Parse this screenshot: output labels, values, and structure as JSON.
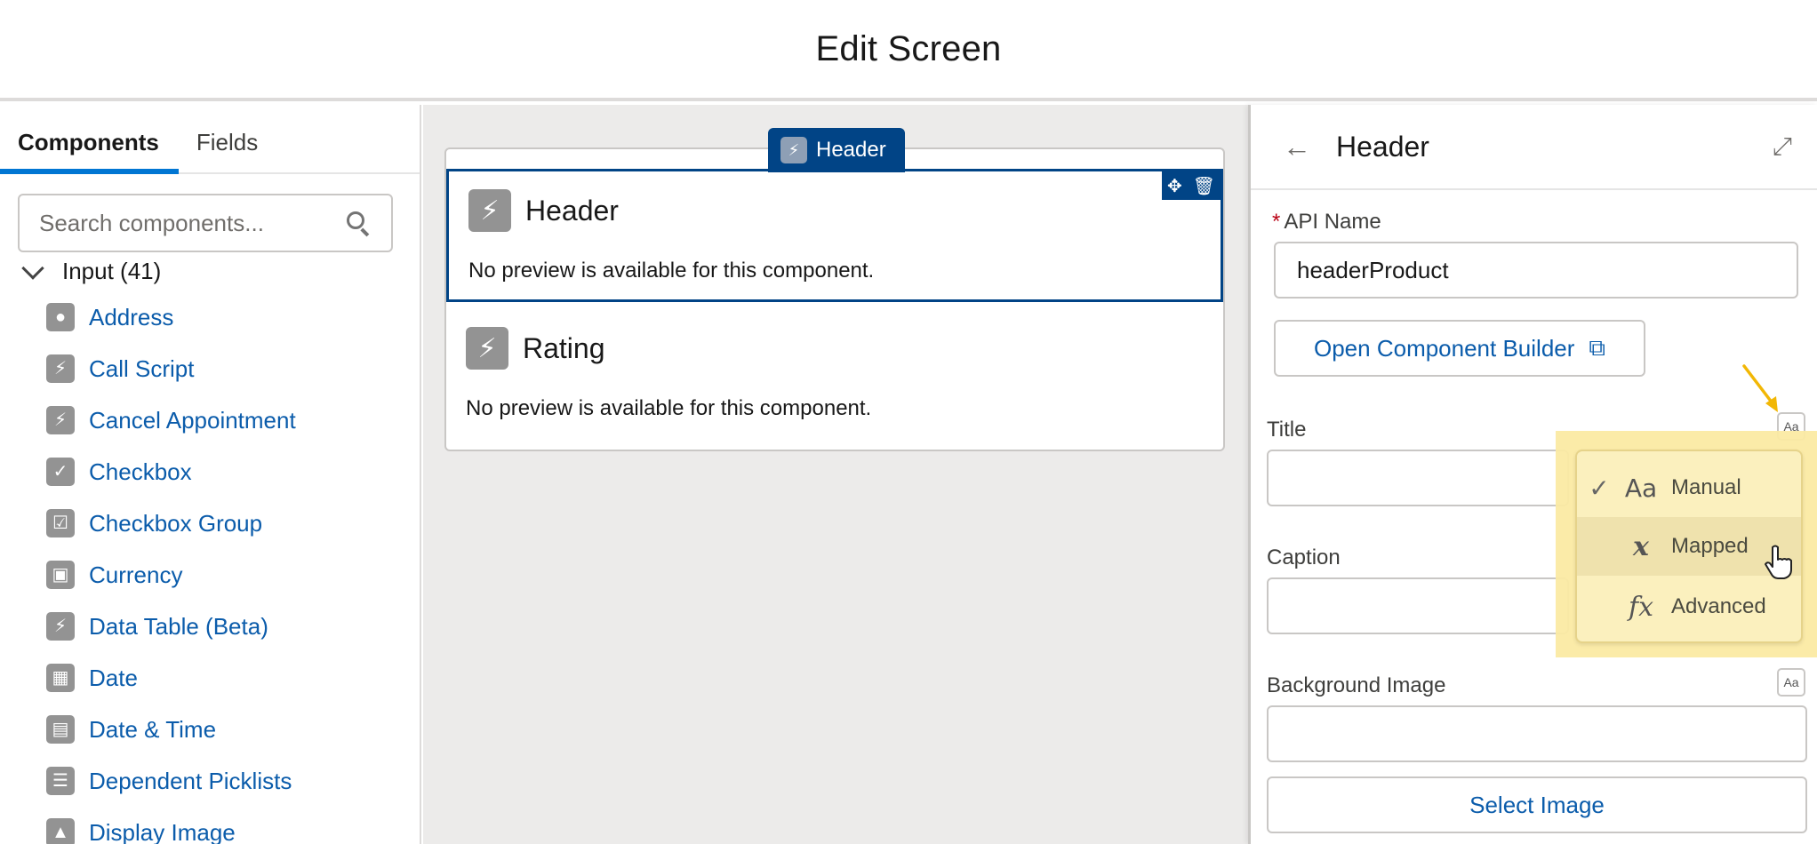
{
  "page": {
    "title": "Edit Screen"
  },
  "left_panel": {
    "tabs": [
      {
        "label": "Components",
        "active": true
      },
      {
        "label": "Fields",
        "active": false
      }
    ],
    "search": {
      "placeholder": "Search components..."
    },
    "section": {
      "label": "Input (41)"
    },
    "items": [
      {
        "label": "Address",
        "icon": "location-icon"
      },
      {
        "label": "Call Script",
        "icon": "lightning-icon"
      },
      {
        "label": "Cancel Appointment",
        "icon": "lightning-icon"
      },
      {
        "label": "Checkbox",
        "icon": "check-icon"
      },
      {
        "label": "Checkbox Group",
        "icon": "checkbox-group-icon"
      },
      {
        "label": "Currency",
        "icon": "currency-icon"
      },
      {
        "label": "Data Table (Beta)",
        "icon": "lightning-icon"
      },
      {
        "label": "Date",
        "icon": "calendar-icon"
      },
      {
        "label": "Date & Time",
        "icon": "calendar-time-icon"
      },
      {
        "label": "Dependent Picklists",
        "icon": "list-icon"
      },
      {
        "label": "Display Image",
        "icon": "image-icon"
      }
    ]
  },
  "canvas": {
    "tag_label": "Header",
    "components": [
      {
        "title": "Header",
        "description": "No preview is available for this component.",
        "selected": true
      },
      {
        "title": "Rating",
        "description": "No preview is available for this component.",
        "selected": false
      }
    ]
  },
  "properties": {
    "title": "Header",
    "api_name_label": "API Name",
    "api_name_required": "*",
    "api_name_value": "headerProduct",
    "open_builder_label": "Open Component Builder",
    "title_label": "Title",
    "caption_label": "Caption",
    "background_label": "Background Image",
    "select_image_label": "Select Image",
    "mode_icon_text": "Aa"
  },
  "mode_menu": {
    "items": [
      {
        "label": "Manual",
        "checked": true,
        "icon": "Aa"
      },
      {
        "label": "Mapped",
        "checked": false,
        "icon": "x"
      },
      {
        "label": "Advanced",
        "checked": false,
        "icon": "fx"
      }
    ]
  },
  "colors": {
    "accent": "#0176d3",
    "selected_border": "#014486",
    "link": "#0b5cab",
    "highlight": "#fbeaa3",
    "arrow": "#f2b705"
  }
}
